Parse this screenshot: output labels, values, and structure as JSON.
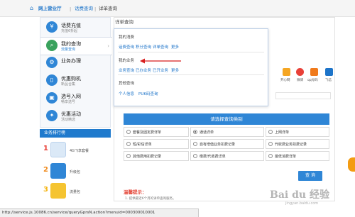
{
  "breadcrumb": {
    "items": [
      "网上营业厅",
      "话费查询",
      "详单查询"
    ],
    "separator": "|"
  },
  "sidebar": {
    "items": [
      {
        "title": "话费充值",
        "subtitle": "充值6折起",
        "icon": "yen-icon"
      },
      {
        "title": "我的查询",
        "subtitle": "流量查询",
        "icon": "search-icon"
      },
      {
        "title": "业务办理",
        "subtitle": "",
        "icon": "gear-icon"
      },
      {
        "title": "优惠购机",
        "subtitle": "新品合集",
        "icon": "phone-icon"
      },
      {
        "title": "选号入网",
        "subtitle": "畅享选号",
        "icon": "sim-icon"
      },
      {
        "title": "优惠活动",
        "subtitle": "活动精选",
        "icon": "gift-icon"
      }
    ]
  },
  "rank": {
    "title": "业务排行榜",
    "items": [
      {
        "num": "1",
        "label": "4G飞享套餐"
      },
      {
        "num": "2",
        "label": "升级包"
      },
      {
        "num": "3",
        "label": "流量包"
      }
    ]
  },
  "main": {
    "title": "详单查询"
  },
  "popup": {
    "section1": {
      "title": "我的消费",
      "links": [
        "话费查询",
        "积分查询",
        "详单查询",
        "更多"
      ]
    },
    "section2": {
      "title": "我的业务",
      "links": [
        "业务查询",
        "已办业务",
        "已开业务",
        "更多"
      ]
    },
    "section3": {
      "title": "其他查询",
      "links": [
        "个人信息",
        "PUK码查询"
      ]
    }
  },
  "right_icons": {
    "labels": [
      "开心网",
      "微博",
      "qq号码",
      "飞信"
    ],
    "colors": [
      "#f5a623",
      "#e94038",
      "#f07a1c",
      "#1d74c9"
    ]
  },
  "query_types": {
    "title": "请选择查询类别",
    "options": [
      {
        "label": "套餐及固定费详单",
        "selected": false
      },
      {
        "label": "通话详单",
        "selected": true
      },
      {
        "label": "上网详单",
        "selected": false
      },
      {
        "label": "短/彩信详单",
        "selected": false
      },
      {
        "label": "自有增值业务扣费记录",
        "selected": false
      },
      {
        "label": "代收费业务扣费记录",
        "selected": false
      },
      {
        "label": "其他费用扣费记录",
        "selected": false
      },
      {
        "label": "缴费/代收费详单",
        "selected": false
      },
      {
        "label": "最低消费详单",
        "selected": false
      }
    ],
    "button": "查 询"
  },
  "tips": {
    "title": "温馨提示：",
    "line1": "1. 提供最近6个月的详单查询服务。"
  },
  "statusbar": {
    "url": "http://service.js.10086.cn/service/queryGprsN.action?menuid=000300010001"
  },
  "watermark": {
    "main": "Bai du 经验",
    "sub": "jingyan.baidu.com"
  }
}
